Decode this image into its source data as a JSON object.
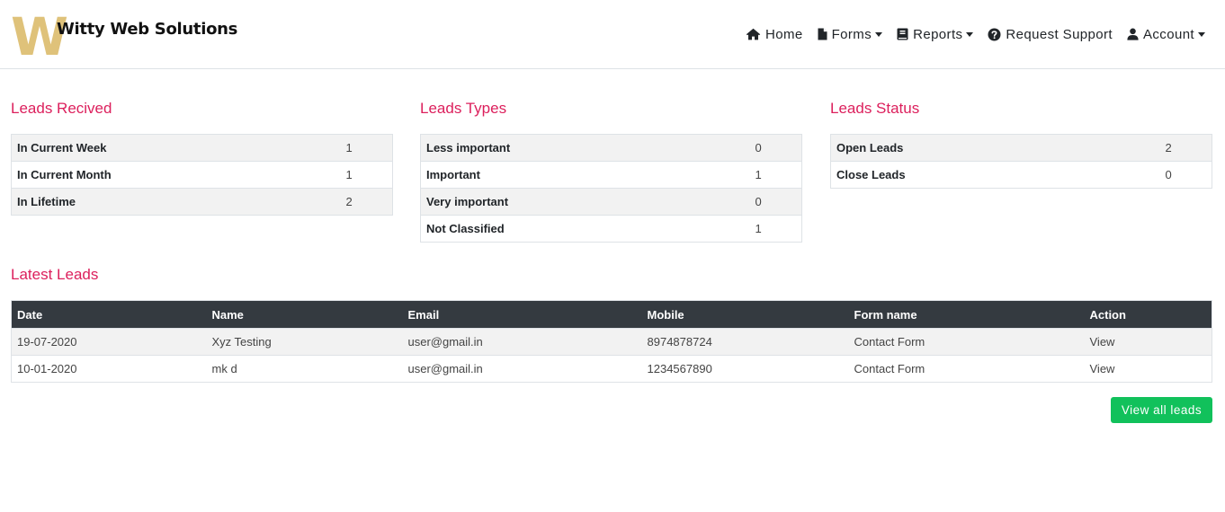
{
  "brand": {
    "logo_letter": "W",
    "name": "Witty Web Solutions",
    "logo_color": "#dfc27a"
  },
  "nav": {
    "items": [
      {
        "label": "Home",
        "icon": "home-icon",
        "dropdown": false
      },
      {
        "label": "Forms",
        "icon": "file-icon",
        "dropdown": true
      },
      {
        "label": "Reports",
        "icon": "book-icon",
        "dropdown": true
      },
      {
        "label": "Request Support",
        "icon": "question-circle-icon",
        "dropdown": false
      },
      {
        "label": "Account",
        "icon": "user-icon",
        "dropdown": true
      }
    ]
  },
  "colors": {
    "heading": "#dc1f5c",
    "table_header": "#343a40",
    "button": "#11c15b"
  },
  "leads_received": {
    "title": "Leads Recived",
    "rows": [
      {
        "label": "In Current Week",
        "value": "1"
      },
      {
        "label": "In Current Month",
        "value": "1"
      },
      {
        "label": "In Lifetime",
        "value": "2"
      }
    ]
  },
  "leads_types": {
    "title": "Leads Types",
    "rows": [
      {
        "label": "Less important",
        "value": "0"
      },
      {
        "label": "Important",
        "value": "1"
      },
      {
        "label": "Very important",
        "value": "0"
      },
      {
        "label": "Not Classified",
        "value": "1"
      }
    ]
  },
  "leads_status": {
    "title": "Leads Status",
    "rows": [
      {
        "label": "Open Leads",
        "value": "2"
      },
      {
        "label": "Close Leads",
        "value": "0"
      }
    ]
  },
  "latest_leads": {
    "title": "Latest Leads",
    "columns": [
      "Date",
      "Name",
      "Email",
      "Mobile",
      "Form name",
      "Action"
    ],
    "rows": [
      {
        "date": "19-07-2020",
        "name": "Xyz Testing",
        "email": "user@gmail.in",
        "mobile": "8974878724",
        "form": "Contact Form",
        "action": "View"
      },
      {
        "date": "10-01-2020",
        "name": "mk d",
        "email": "user@gmail.in",
        "mobile": "1234567890",
        "form": "Contact Form",
        "action": "View"
      }
    ],
    "view_all_label": "View all leads"
  }
}
